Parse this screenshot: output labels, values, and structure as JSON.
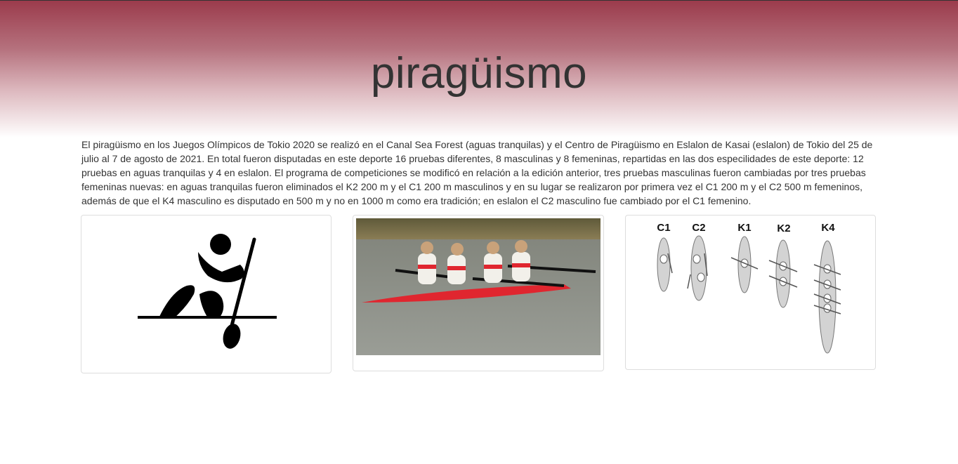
{
  "header": {
    "title": "piragüismo"
  },
  "intro": {
    "text": "El piragüismo en los Juegos Olímpicos de Tokio 2020 se realizó en el Canal Sea Forest (aguas tranquilas) y el Centro de Piragüismo en Eslalon de Kasai (eslalon) de Tokio del 25 de julio al 7 de agosto de 2021. En total fueron disputadas en este deporte 16 pruebas diferentes, 8 masculinas y 8 femeninas, repartidas en las dos especilidades de este deporte: 12 pruebas en aguas tranquilas y 4 en eslalon. El programa de competiciones se modificó en relación a la edición anterior, tres pruebas masculinas fueron cambiadas por tres pruebas femeninas nuevas: en aguas tranquilas fueron eliminados el K2 200 m y el C1 200 m masculinos y en su lugar se realizaron por primera vez el C1 200 m y el C2 500 m femeninos, además de que el K4 masculino es disputado en 500 m y no en 1000 m como era tradición; en eslalon el C2 masculino fue cambiado por el C1 femenino."
  },
  "gallery": {
    "boat_labels": [
      "C1",
      "C2",
      "K1",
      "K2",
      "K4"
    ]
  },
  "colors": {
    "header_top": "#9b3b4c",
    "text": "#333333",
    "card_border": "#dddddd"
  }
}
